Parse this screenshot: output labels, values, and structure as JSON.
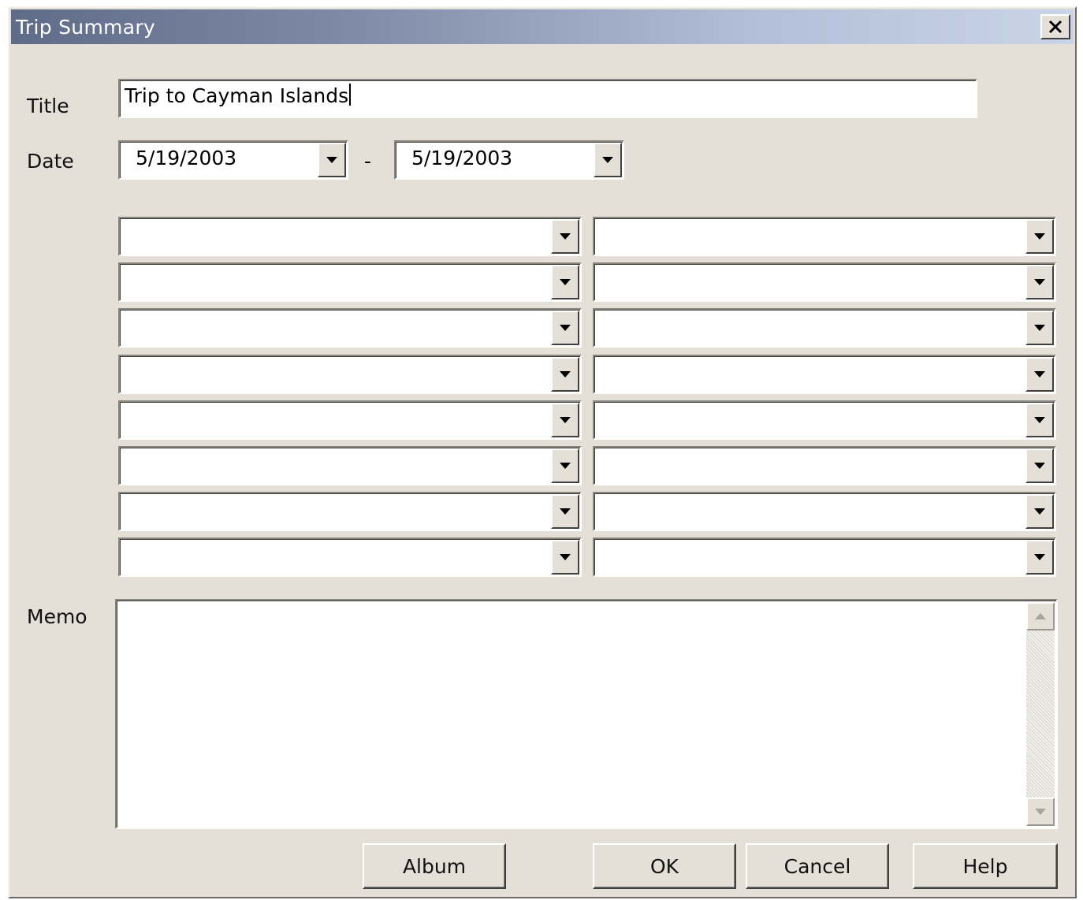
{
  "window": {
    "title": "Trip Summary",
    "close_icon": "close-icon"
  },
  "form": {
    "title_label": "Title",
    "title_value": "Trip to Cayman Islands",
    "date_label": "Date",
    "date_start": "5/19/2003",
    "date_separator": "-",
    "date_end": "5/19/2003",
    "combo_rows": 8,
    "memo_label": "Memo",
    "memo_value": ""
  },
  "buttons": {
    "album": "Album",
    "ok": "OK",
    "cancel": "Cancel",
    "help": "Help"
  },
  "colors": {
    "face": "#e4e0d8",
    "title_start": "#5f6c89",
    "title_end": "#c9d4e8"
  }
}
